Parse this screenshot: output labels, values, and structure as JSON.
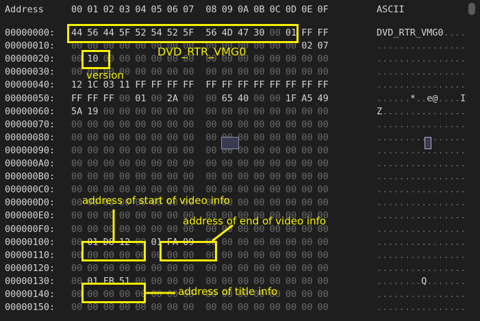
{
  "header": {
    "address_label": "Address",
    "columns": [
      "00",
      "01",
      "02",
      "03",
      "04",
      "05",
      "06",
      "07",
      "08",
      "09",
      "0A",
      "0B",
      "0C",
      "0D",
      "0E",
      "0F"
    ],
    "ascii_label": "ASCII"
  },
  "rows": [
    {
      "addr": "00000000:",
      "bytes": [
        "44",
        "56",
        "44",
        "5F",
        "52",
        "54",
        "52",
        "5F",
        "56",
        "4D",
        "47",
        "30",
        "00",
        "01",
        "FF",
        "FF"
      ],
      "ascii": "DVD_RTR_VMG0...."
    },
    {
      "addr": "00000010:",
      "bytes": [
        "00",
        "00",
        "00",
        "00",
        "00",
        "00",
        "00",
        "00",
        "00",
        "00",
        "00",
        "00",
        "00",
        "00",
        "02",
        "07"
      ],
      "ascii": "................"
    },
    {
      "addr": "00000020:",
      "bytes": [
        "00",
        "10",
        "00",
        "00",
        "00",
        "00",
        "00",
        "00",
        "00",
        "00",
        "00",
        "00",
        "00",
        "00",
        "00",
        "00"
      ],
      "ascii": "................"
    },
    {
      "addr": "00000030:",
      "bytes": [
        "00",
        "00",
        "00",
        "00",
        "00",
        "00",
        "00",
        "00",
        "00",
        "00",
        "00",
        "00",
        "00",
        "00",
        "00",
        "00"
      ],
      "ascii": "................"
    },
    {
      "addr": "00000040:",
      "bytes": [
        "12",
        "1C",
        "03",
        "11",
        "FF",
        "FF",
        "FF",
        "FF",
        "FF",
        "FF",
        "FF",
        "FF",
        "FF",
        "FF",
        "FF",
        "FF"
      ],
      "ascii": "................"
    },
    {
      "addr": "00000050:",
      "bytes": [
        "FF",
        "FF",
        "FF",
        "00",
        "01",
        "00",
        "2A",
        "00",
        "00",
        "65",
        "40",
        "00",
        "00",
        "1F",
        "A5",
        "49"
      ],
      "ascii": "......*..e@....I"
    },
    {
      "addr": "00000060:",
      "bytes": [
        "5A",
        "19",
        "00",
        "00",
        "00",
        "00",
        "00",
        "00",
        "00",
        "00",
        "00",
        "00",
        "00",
        "00",
        "00",
        "00"
      ],
      "ascii": "Z..............."
    },
    {
      "addr": "00000070:",
      "bytes": [
        "00",
        "00",
        "00",
        "00",
        "00",
        "00",
        "00",
        "00",
        "00",
        "00",
        "00",
        "00",
        "00",
        "00",
        "00",
        "00"
      ],
      "ascii": "................"
    },
    {
      "addr": "00000080:",
      "bytes": [
        "00",
        "00",
        "00",
        "00",
        "00",
        "00",
        "00",
        "00",
        "00",
        "00",
        "00",
        "00",
        "00",
        "00",
        "00",
        "00"
      ],
      "ascii": "................"
    },
    {
      "addr": "00000090:",
      "bytes": [
        "00",
        "00",
        "00",
        "00",
        "00",
        "00",
        "00",
        "00",
        "00",
        "00",
        "00",
        "00",
        "00",
        "00",
        "00",
        "00"
      ],
      "ascii": "................"
    },
    {
      "addr": "000000A0:",
      "bytes": [
        "00",
        "00",
        "00",
        "00",
        "00",
        "00",
        "00",
        "00",
        "00",
        "00",
        "00",
        "00",
        "00",
        "00",
        "00",
        "00"
      ],
      "ascii": "................"
    },
    {
      "addr": "000000B0:",
      "bytes": [
        "00",
        "00",
        "00",
        "00",
        "00",
        "00",
        "00",
        "00",
        "00",
        "00",
        "00",
        "00",
        "00",
        "00",
        "00",
        "00"
      ],
      "ascii": "................"
    },
    {
      "addr": "000000C0:",
      "bytes": [
        "00",
        "00",
        "00",
        "00",
        "00",
        "00",
        "00",
        "00",
        "00",
        "00",
        "00",
        "00",
        "00",
        "00",
        "00",
        "00"
      ],
      "ascii": "................"
    },
    {
      "addr": "000000D0:",
      "bytes": [
        "00",
        "00",
        "00",
        "00",
        "00",
        "00",
        "00",
        "00",
        "00",
        "00",
        "00",
        "00",
        "00",
        "00",
        "00",
        "00"
      ],
      "ascii": "................"
    },
    {
      "addr": "000000E0:",
      "bytes": [
        "00",
        "00",
        "00",
        "00",
        "00",
        "00",
        "00",
        "00",
        "00",
        "00",
        "00",
        "00",
        "00",
        "00",
        "00",
        "00"
      ],
      "ascii": "................"
    },
    {
      "addr": "000000F0:",
      "bytes": [
        "00",
        "00",
        "00",
        "00",
        "00",
        "00",
        "00",
        "00",
        "00",
        "00",
        "00",
        "00",
        "00",
        "00",
        "00",
        "00"
      ],
      "ascii": "................"
    },
    {
      "addr": "00000100:",
      "bytes": [
        "00",
        "01",
        "D8",
        "12",
        "00",
        "01",
        "FA",
        "09",
        "00",
        "00",
        "00",
        "00",
        "00",
        "00",
        "00",
        "00"
      ],
      "ascii": "................"
    },
    {
      "addr": "00000110:",
      "bytes": [
        "00",
        "00",
        "00",
        "00",
        "00",
        "00",
        "00",
        "00",
        "00",
        "00",
        "00",
        "00",
        "00",
        "00",
        "00",
        "00"
      ],
      "ascii": "................"
    },
    {
      "addr": "00000120:",
      "bytes": [
        "00",
        "00",
        "00",
        "00",
        "00",
        "00",
        "00",
        "00",
        "00",
        "00",
        "00",
        "00",
        "00",
        "00",
        "00",
        "00"
      ],
      "ascii": "................"
    },
    {
      "addr": "00000130:",
      "bytes": [
        "00",
        "01",
        "FB",
        "51",
        "00",
        "00",
        "00",
        "00",
        "00",
        "00",
        "00",
        "00",
        "00",
        "00",
        "00",
        "00"
      ],
      "ascii": "........Q......."
    },
    {
      "addr": "00000140:",
      "bytes": [
        "00",
        "00",
        "00",
        "00",
        "00",
        "00",
        "00",
        "00",
        "00",
        "00",
        "00",
        "00",
        "00",
        "00",
        "00",
        "00"
      ],
      "ascii": "................"
    },
    {
      "addr": "00000150:",
      "bytes": [
        "00",
        "00",
        "00",
        "00",
        "00",
        "00",
        "00",
        "00",
        "00",
        "00",
        "00",
        "00",
        "00",
        "00",
        "00",
        "00"
      ],
      "ascii": "................"
    }
  ],
  "annotations": {
    "signature": "DVD_RTR_VMG0",
    "version": "version",
    "video_start": "address of start of video info",
    "video_end": "address of end of video info",
    "title_info": "address of title info"
  },
  "colors": {
    "highlight": "#f5f000",
    "background": "#1e1e1e",
    "text": "#d4d4d4",
    "zero": "#6a6a6a"
  }
}
